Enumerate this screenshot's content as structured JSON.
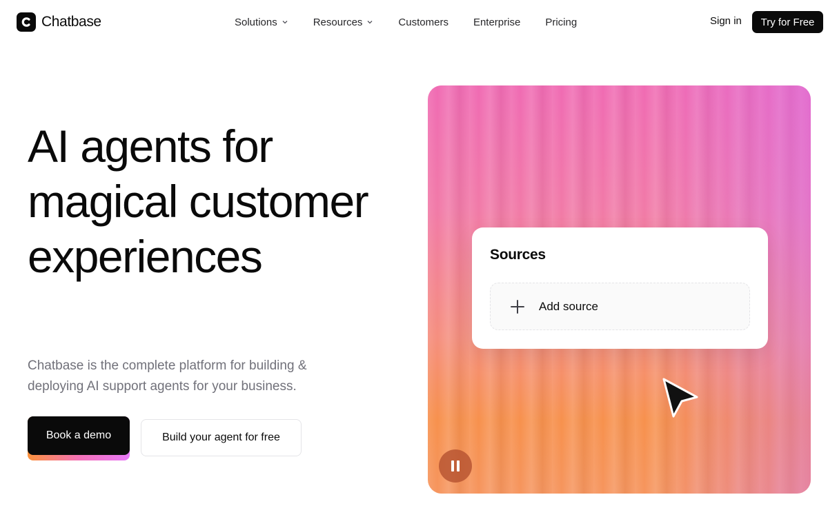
{
  "header": {
    "logo_text": "Chatbase",
    "nav": [
      {
        "label": "Solutions",
        "has_dropdown": true
      },
      {
        "label": "Resources",
        "has_dropdown": true
      },
      {
        "label": "Customers",
        "has_dropdown": false
      },
      {
        "label": "Enterprise",
        "has_dropdown": false
      },
      {
        "label": "Pricing",
        "has_dropdown": false
      }
    ],
    "sign_in": "Sign in",
    "try_free": "Try for Free"
  },
  "hero": {
    "title": "AI agents for magical customer experiences",
    "subtitle": "Chatbase is the complete platform for building & deploying AI support agents for your business.",
    "primary_cta": "Book a demo",
    "secondary_cta": "Build your agent for free"
  },
  "media": {
    "card_title": "Sources",
    "add_source_label": "Add source",
    "icons": [
      "plus-icon",
      "cursor-arrow-icon",
      "pause-icon"
    ]
  },
  "colors": {
    "primary": "#0a0a0a",
    "muted_text": "#71717a",
    "gradient_pink": "#f06bb3",
    "gradient_orange": "#f7914d",
    "gradient_violet": "#e879f9"
  }
}
